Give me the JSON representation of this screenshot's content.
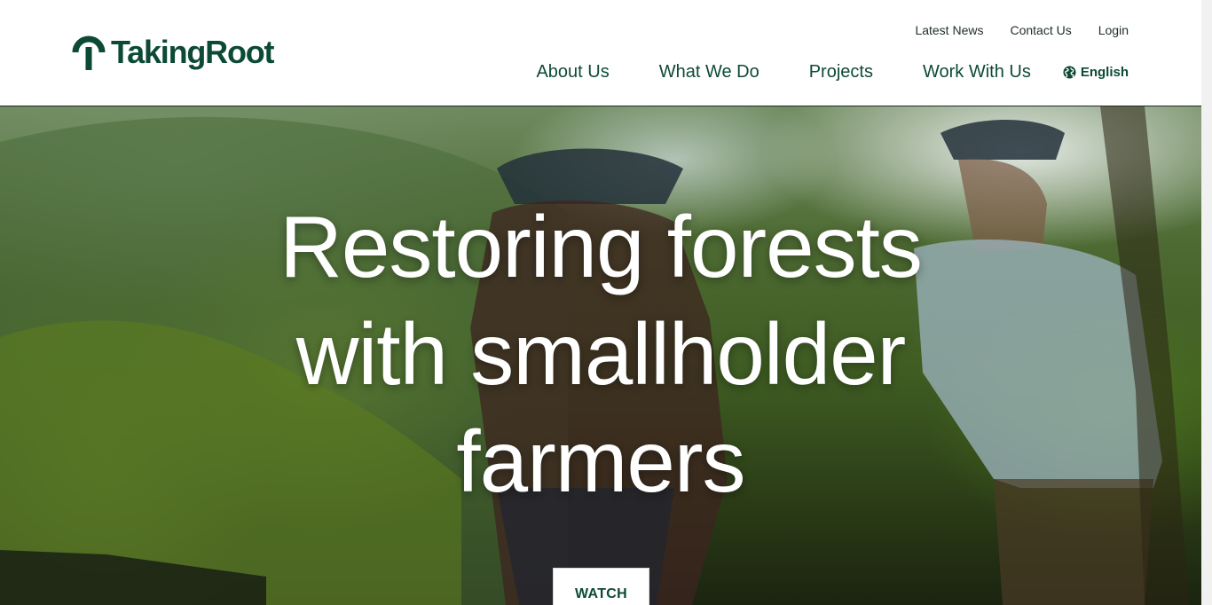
{
  "brand": {
    "name": "TakingRoot",
    "color": "#0d4a36"
  },
  "util_nav": {
    "items": [
      {
        "label": "Latest News"
      },
      {
        "label": "Contact Us"
      },
      {
        "label": "Login"
      }
    ]
  },
  "main_nav": {
    "items": [
      {
        "label": "About Us"
      },
      {
        "label": "What We Do"
      },
      {
        "label": "Projects"
      },
      {
        "label": "Work With Us"
      }
    ],
    "language": {
      "label": "English",
      "icon": "globe-icon"
    }
  },
  "hero": {
    "title": "Restoring forests with smallholder farmers",
    "cta_label": "WATCH"
  }
}
